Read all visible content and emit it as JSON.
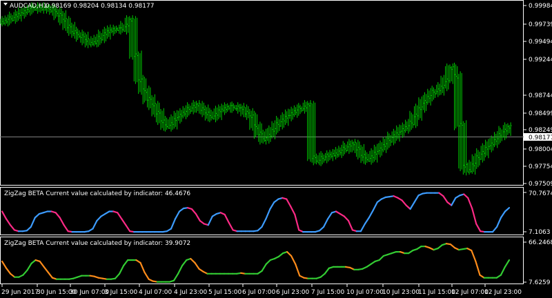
{
  "colors": {
    "background": "#000000",
    "grid": "#ffffff",
    "bar": "#00cc00",
    "current_price_line": "#808080",
    "indicator1_up": "#3d9cff",
    "indicator1_down": "#ff2a86",
    "indicator2_up": "#33cc33",
    "indicator2_down": "#ff8c1a",
    "text": "#ffffff"
  },
  "main_chart": {
    "symbol": "AUDCAD,H1",
    "ohlc": "0.98169 0.98204 0.98134 0.98177",
    "current_price": "0.98177",
    "price_ticks": [
      "0.99984",
      "0.99739",
      "0.99494",
      "0.99244",
      "0.98744",
      "0.98499",
      "0.98249",
      "0.98004",
      "0.97754",
      "0.97509"
    ]
  },
  "indicator_1": {
    "header": "ZigZag BETA Current value calculated by indicator: 46.4676",
    "max": "70.7674",
    "min": "7.1063"
  },
  "indicator_2": {
    "header": "ZigZag BETA Current value calculated by indicator: 39.9072",
    "max": "66.2468",
    "min": "7.6259"
  },
  "time_axis": {
    "labels": [
      "29 Jun 2017",
      "30 Jun 15:00",
      "30 Jun 07:00",
      "3 Jul 15:00",
      "4 Jul 07:00",
      "4 Jul 23:00",
      "5 Jul 15:00",
      "6 Jul 07:00",
      "6 Jul 23:00",
      "7 Jul 15:00",
      "10 Jul 07:00",
      "10 Jul 23:00",
      "11 Jul 15:00",
      "12 Jul 07:00",
      "12 Jul 23:00"
    ]
  },
  "chart_data": [
    {
      "type": "line",
      "title": "AUDCAD,H1",
      "ylim": [
        0.97509,
        0.99984
      ],
      "x_points": 115,
      "series": [
        {
          "name": "",
          "values": [
            0.9975,
            0.9978,
            0.998,
            0.9983,
            0.9986,
            0.999,
            0.9993,
            0.9995,
            0.9996,
            0.9994,
            0.9996,
            0.9993,
            0.999,
            0.9985,
            0.9978,
            0.997,
            0.9962,
            0.9958,
            0.9955,
            0.995,
            0.9946,
            0.9948,
            0.9953,
            0.9958,
            0.9962,
            0.9965,
            0.9966,
            0.9965,
            0.997,
            0.9978,
            0.993,
            0.9895,
            0.988,
            0.9868,
            0.986,
            0.985,
            0.9838,
            0.983,
            0.9833,
            0.984,
            0.9846,
            0.985,
            0.9854,
            0.9857,
            0.986,
            0.9855,
            0.9849,
            0.9843,
            0.9846,
            0.9852,
            0.9855,
            0.9858,
            0.9857,
            0.9856,
            0.9855,
            0.985,
            0.9845,
            0.983,
            0.982,
            0.9812,
            0.9818,
            0.9826,
            0.9833,
            0.9838,
            0.9843,
            0.9848,
            0.9852,
            0.9855,
            0.9856,
            0.986,
            0.9788,
            0.9782,
            0.9786,
            0.9789,
            0.979,
            0.9792,
            0.9796,
            0.9799,
            0.9803,
            0.9806,
            0.98,
            0.979,
            0.9784,
            0.9787,
            0.9793,
            0.9799,
            0.9805,
            0.9811,
            0.9816,
            0.982,
            0.9826,
            0.983,
            0.9835,
            0.9845,
            0.9855,
            0.9865,
            0.9872,
            0.9878,
            0.988,
            0.9885,
            0.9895,
            0.9912,
            0.99,
            0.9832,
            0.9775,
            0.9769,
            0.9778,
            0.9787,
            0.9793,
            0.98,
            0.9806,
            0.9812,
            0.9818,
            0.9824,
            0.9829
          ]
        }
      ]
    },
    {
      "type": "line",
      "title": "ZigZag BETA",
      "ylim": [
        7.1063,
        70.7674
      ],
      "x_points": 115,
      "series": [
        {
          "name": "",
          "values": [
            40,
            28,
            18,
            10,
            8,
            8,
            9,
            15,
            30,
            36,
            38,
            40,
            40,
            38,
            30,
            18,
            8,
            7,
            7,
            7,
            7,
            8,
            12,
            25,
            32,
            36,
            40,
            40,
            38,
            28,
            18,
            8,
            7,
            7,
            7,
            7,
            7,
            7,
            7,
            7,
            8,
            12,
            28,
            40,
            45,
            46,
            44,
            36,
            25,
            20,
            18,
            32,
            36,
            38,
            35,
            22,
            10,
            8,
            8,
            8,
            8,
            8,
            9,
            15,
            28,
            44,
            55,
            60,
            62,
            60,
            48,
            35,
            10,
            7,
            7,
            7,
            7,
            9,
            15,
            28,
            38,
            40,
            36,
            32,
            25,
            10,
            8,
            8,
            20,
            30,
            42,
            55,
            60,
            63,
            64,
            65,
            62,
            58,
            50,
            44,
            55,
            66,
            69,
            70,
            70,
            70,
            70,
            65,
            55,
            50,
            62,
            66,
            68,
            62,
            45,
            20,
            8,
            7,
            7,
            7,
            15,
            30,
            40,
            46
          ]
        }
      ]
    },
    {
      "type": "line",
      "title": "ZigZag BETA",
      "ylim": [
        7.6259,
        66.2468
      ],
      "x_points": 115,
      "series": [
        {
          "name": "",
          "values": [
            38,
            28,
            20,
            15,
            15,
            18,
            25,
            35,
            40,
            38,
            30,
            22,
            14,
            12,
            12,
            12,
            12,
            13,
            15,
            17,
            17,
            17,
            16,
            14,
            13,
            12,
            12,
            13,
            20,
            32,
            40,
            40,
            40,
            36,
            22,
            12,
            9,
            8,
            8,
            8,
            8,
            10,
            20,
            32,
            40,
            42,
            36,
            27,
            23,
            20,
            20,
            20,
            20,
            20,
            20,
            20,
            20,
            21,
            20,
            20,
            20,
            20,
            24,
            34,
            40,
            42,
            45,
            50,
            52,
            46,
            34,
            17,
            14,
            13,
            13,
            13,
            15,
            20,
            28,
            30,
            30,
            30,
            30,
            29,
            26,
            26,
            27,
            30,
            34,
            38,
            40,
            46,
            48,
            50,
            52,
            52,
            50,
            50,
            54,
            56,
            60,
            60,
            58,
            55,
            57,
            62,
            64,
            63,
            58,
            55,
            56,
            57,
            54,
            38,
            18,
            14,
            14,
            14,
            14,
            18,
            30,
            40
          ]
        }
      ]
    }
  ]
}
